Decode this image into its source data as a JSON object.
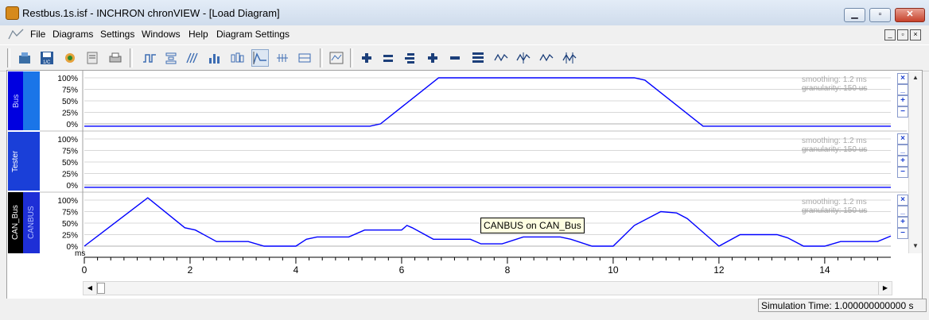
{
  "window": {
    "title": "Restbus.1s.isf  -  INCHRON chronVIEW - [Load Diagram]",
    "minimize_icon": "minimize-icon",
    "maximize_icon": "maximize-icon",
    "close_icon": "close-icon"
  },
  "menubar": {
    "items": [
      "File",
      "Diagrams",
      "Settings",
      "Windows",
      "Help",
      "Diagram Settings"
    ],
    "mdi": [
      "_",
      "▫",
      "×"
    ]
  },
  "toolbar": {
    "icons": [
      "new-diagram-icon",
      "save-icon",
      "cpu-icon",
      "gear-tasks-icon",
      "report-icon",
      "print-icon",
      "state-diagram-icon",
      "stack-diagram-icon",
      "gantt-diagram-icon",
      "bar-chart-icon",
      "boxplot-icon",
      "load-diagram-icon",
      "event-diagram-icon",
      "range-diagram-icon",
      "filter-icon",
      "add-row-icon",
      "remove-row-icon",
      "stack-rows-icon",
      "zoom-in-icon",
      "zoom-out-icon",
      "full-height-icon",
      "wave-icon",
      "wave-marker-icon",
      "wave-peak-icon",
      "wave-grid-icon"
    ]
  },
  "lanes": [
    {
      "outer": "",
      "inner": "Bus",
      "color_outer": "#0000e0",
      "color_inner": "#1a75e8",
      "smoothing": "smoothing: 1.2 ms",
      "granularity": "granularity: 150 us"
    },
    {
      "outer": "Tester",
      "inner": "",
      "color_outer": "#1a3fd8",
      "color_inner": "#1a3fd8",
      "smoothing": "smoothing: 1.2 ms",
      "granularity": "granularity: 150 us"
    },
    {
      "outer": "CAN_Bus",
      "inner": "CANBUS",
      "color_outer": "#000000",
      "color_inner": "#1e2fd6",
      "smoothing": "smoothing: 1.2 ms",
      "granularity": "granularity: 150 us"
    }
  ],
  "lane_controls": [
    "×",
    "_",
    "+",
    "−"
  ],
  "y_ticks": [
    "100%",
    "75%",
    "50%",
    "25%",
    "0%"
  ],
  "x_axis": {
    "unit": "ms",
    "labels": [
      "0",
      "2",
      "4",
      "6",
      "8",
      "10",
      "12",
      "14"
    ]
  },
  "tooltip": "CANBUS on CAN_Bus",
  "status": {
    "simulation_time": "Simulation Time: 1.000000000000 s"
  },
  "colors": {
    "trace": "#0000ff",
    "grid": "#d8d8d8",
    "tooltip_bg": "#ffffe1"
  },
  "chart_data": [
    {
      "type": "line",
      "title": "Bus",
      "ylabel": "",
      "xlabel": "ms",
      "xlim": [
        0,
        15.25
      ],
      "ylim": [
        0,
        100
      ],
      "series": [
        {
          "name": "",
          "x": [
            0,
            5.4,
            5.6,
            6.7,
            10.4,
            10.6,
            11.7,
            15.25
          ],
          "values": [
            -5,
            -5,
            0,
            100,
            100,
            95,
            -5,
            -5
          ]
        }
      ]
    },
    {
      "type": "line",
      "title": "Tester",
      "ylabel": "",
      "xlabel": "ms",
      "xlim": [
        0,
        15.25
      ],
      "ylim": [
        0,
        100
      ],
      "series": [
        {
          "name": "",
          "x": [
            0,
            15.25
          ],
          "values": [
            -5,
            -5
          ]
        }
      ]
    },
    {
      "type": "line",
      "title": "CANBUS",
      "ylabel": "",
      "xlabel": "ms",
      "xlim": [
        0,
        15.25
      ],
      "ylim": [
        0,
        100
      ],
      "series": [
        {
          "name": "CANBUS on CAN_Bus",
          "x": [
            0,
            1.2,
            1.9,
            2.1,
            2.5,
            3.1,
            3.4,
            4.0,
            4.2,
            4.4,
            5.0,
            5.3,
            6.0,
            6.1,
            6.2,
            6.6,
            7.3,
            7.5,
            7.9,
            8.3,
            9.0,
            9.2,
            9.6,
            10.0,
            10.4,
            10.9,
            11.2,
            11.4,
            12.0,
            12.4,
            13.1,
            13.3,
            13.6,
            14.0,
            14.3,
            15.0,
            15.25
          ],
          "values": [
            0,
            105,
            40,
            35,
            10,
            10,
            0,
            0,
            15,
            20,
            20,
            35,
            35,
            45,
            40,
            15,
            15,
            5,
            5,
            20,
            20,
            15,
            0,
            0,
            45,
            75,
            72,
            60,
            0,
            25,
            25,
            18,
            0,
            0,
            10,
            10,
            22
          ]
        }
      ]
    }
  ]
}
